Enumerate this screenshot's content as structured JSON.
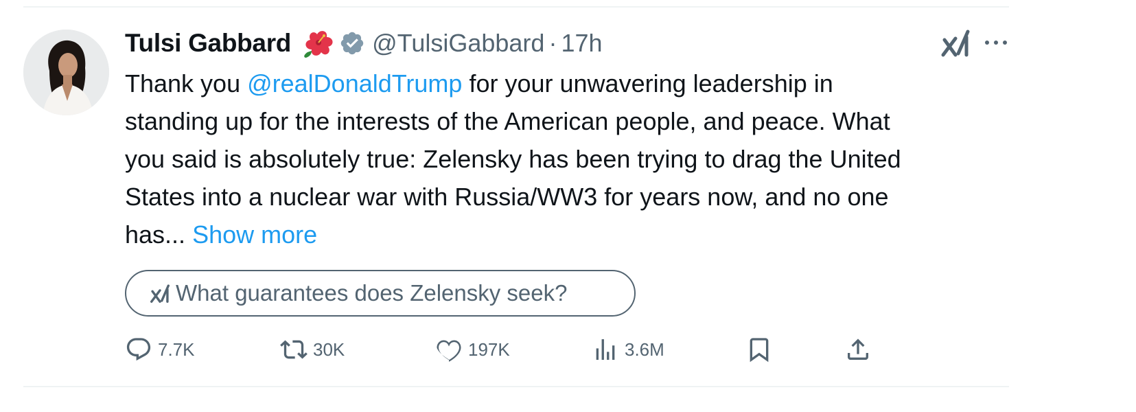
{
  "tweet": {
    "author_name": "Tulsi Gabbard",
    "author_emoji": "🌺",
    "author_handle": "@TulsiGabbard",
    "separator": "·",
    "time": "17h",
    "text_lines": [
      [
        "Thank you ",
        "@realDonaldTrump",
        " for your unwavering leadership in"
      ],
      [
        "standing up for the interests of the American people, and peace. What"
      ],
      [
        "you said is absolutely true: Zelensky has been trying to drag the United"
      ],
      [
        "States into a nuclear war with Russia/WW3 for years now, and no one"
      ],
      [
        "has... ",
        "Show more"
      ]
    ],
    "grok_prompt": "What guarantees does Zelensky seek?",
    "stats": {
      "replies": "7.7K",
      "retweets": "30K",
      "likes": "197K",
      "views": "3.6M"
    }
  },
  "icons": [
    "grok-icon",
    "more-icon",
    "verified-icon",
    "reply-icon",
    "retweet-icon",
    "like-icon",
    "views-icon",
    "bookmark-icon",
    "share-icon"
  ],
  "colors": {
    "link": "#1d9bf0",
    "text": "#0f1419",
    "muted": "#536471",
    "divider": "#eff3f4"
  }
}
